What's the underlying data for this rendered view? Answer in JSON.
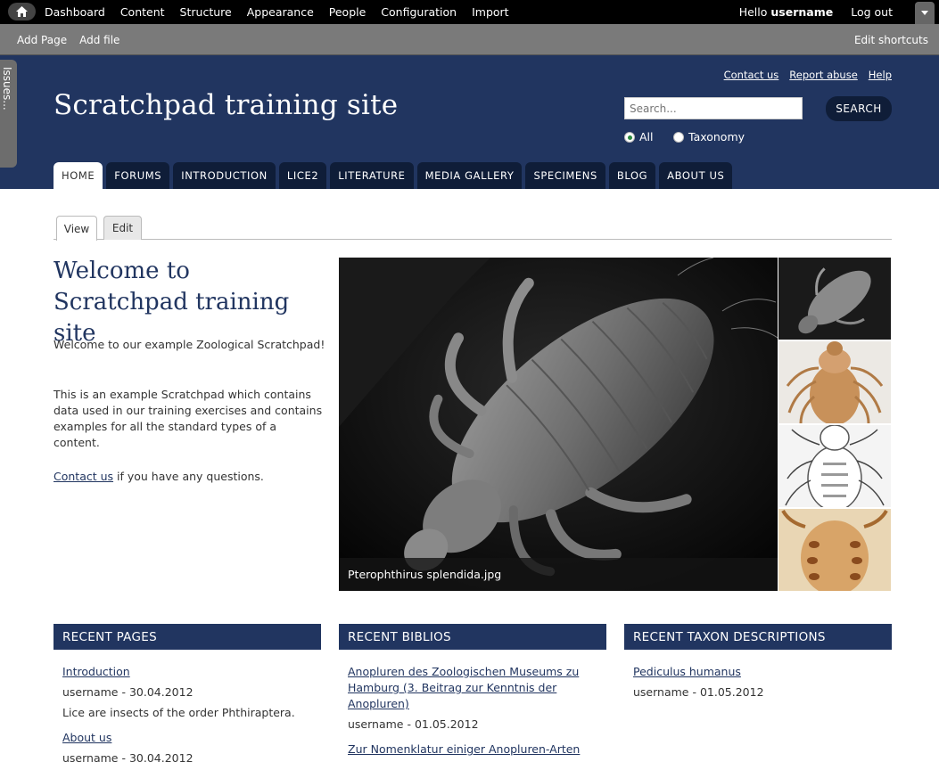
{
  "admin_bar": {
    "menu": [
      "Dashboard",
      "Content",
      "Structure",
      "Appearance",
      "People",
      "Configuration",
      "Import"
    ],
    "hello": "Hello",
    "username": "username",
    "logout": "Log out"
  },
  "shortcuts": {
    "links": [
      "Add Page",
      "Add file"
    ],
    "edit": "Edit shortcuts"
  },
  "issues_tab": "Issues...",
  "header": {
    "site_title": "Scratchpad training site",
    "links": [
      "Contact us",
      "Report abuse",
      "Help"
    ],
    "search_placeholder": "Search...",
    "search_button": "SEARCH",
    "radio_all": "All",
    "radio_taxonomy": "Taxonomy"
  },
  "nav": [
    "HOME",
    "FORUMS",
    "INTRODUCTION",
    "LICE2",
    "LITERATURE",
    "MEDIA GALLERY",
    "SPECIMENS",
    "BLOG",
    "ABOUT US"
  ],
  "local_tabs": {
    "view": "View",
    "edit": "Edit"
  },
  "welcome": {
    "title": "Welcome to Scratchpad training site",
    "p1": "Welcome to our example Zoological Scratchpad!",
    "p2": "This is an example Scratchpad which contains data used in our training exercises and contains examples for all the standard types of a content.",
    "contact_link": "Contact us",
    "contact_rest": " if you have any questions."
  },
  "slideshow": {
    "caption": "Pterophthirus splendida.jpg"
  },
  "recent_pages": {
    "title": "RECENT PAGES",
    "items": [
      {
        "link": "Introduction",
        "meta": "username - 30.04.2012",
        "teaser": "Lice are insects of the order Phthiraptera."
      },
      {
        "link": "About us",
        "meta": "username - 30.04.2012"
      }
    ]
  },
  "recent_biblios": {
    "title": "RECENT BIBLIOS",
    "items": [
      {
        "link": "Anopluren des Zoologischen Museums zu Hamburg (3. Beitrag zur Kenntnis der Anopluren)",
        "meta": "username - 01.05.2012"
      },
      {
        "link": "Zur Nomenklatur einiger Anopluren-Arten"
      }
    ]
  },
  "recent_taxon": {
    "title": "RECENT TAXON DESCRIPTIONS",
    "items": [
      {
        "link": "Pediculus humanus",
        "meta": "username - 01.05.2012"
      }
    ]
  }
}
